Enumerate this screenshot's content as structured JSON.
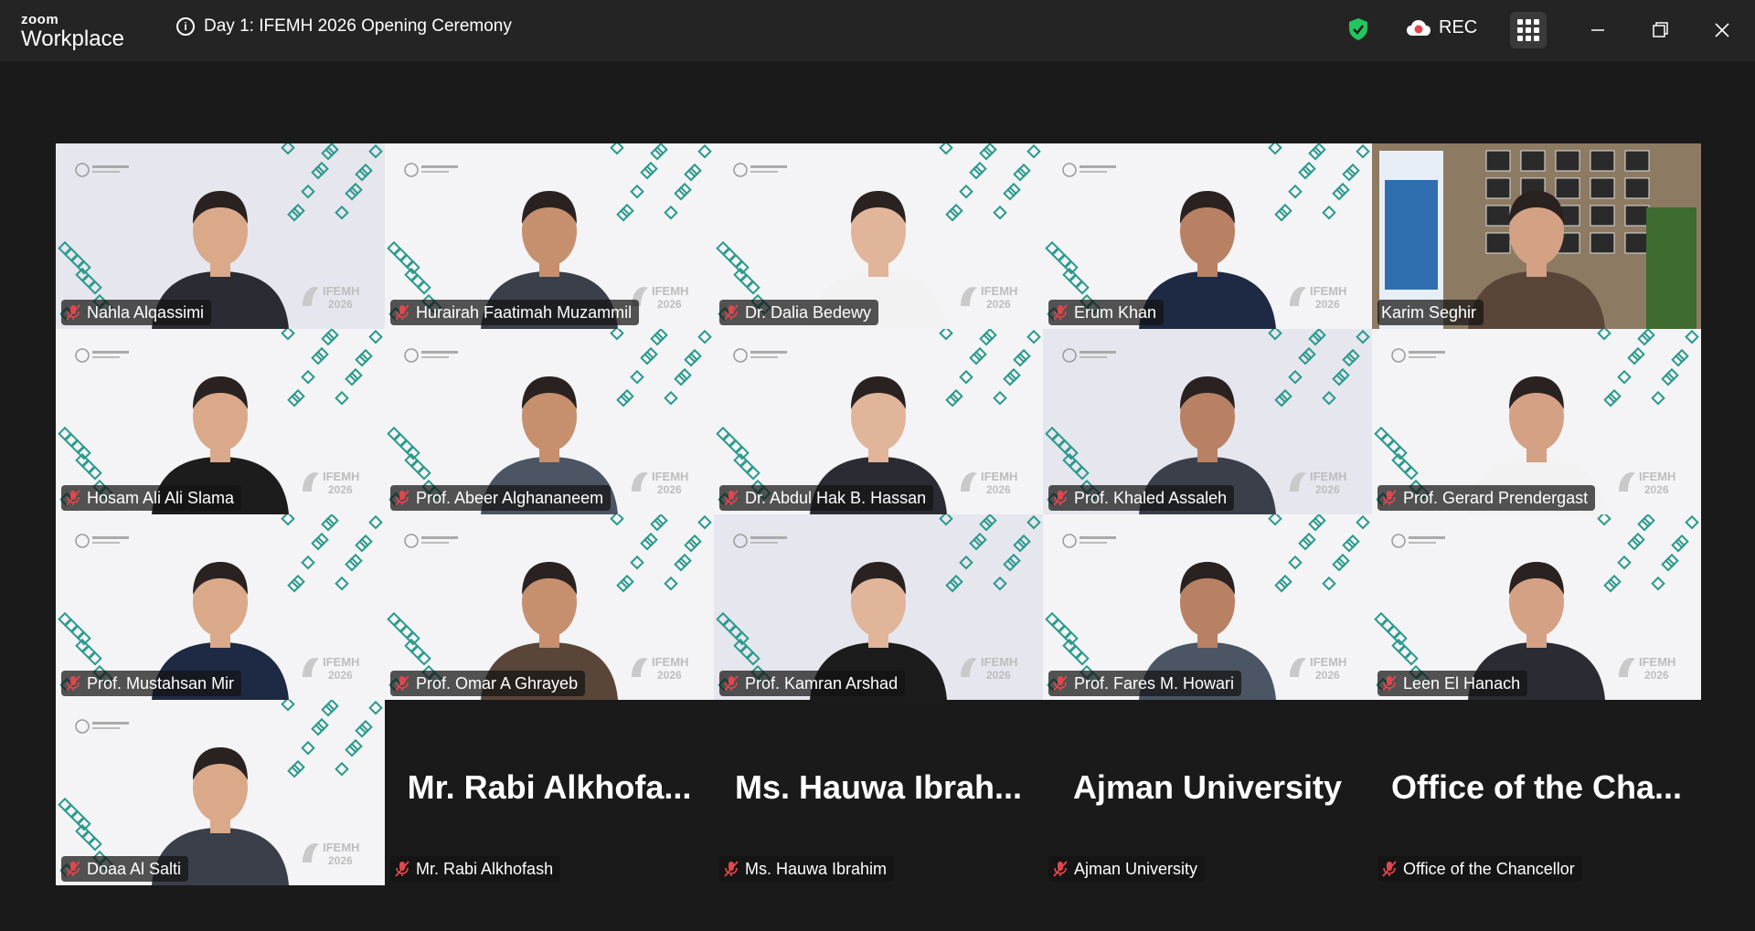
{
  "app": {
    "brand_top": "zoom",
    "brand_bottom": "Workplace"
  },
  "meeting": {
    "title": "Day 1: IFEMH 2026 Opening Ceremony"
  },
  "toolbar": {
    "rec_label": "REC"
  },
  "colors": {
    "titlebar_bg": "#242424",
    "page_bg": "#1a1a1a",
    "active_border": "#22c55e",
    "shield": "#22c55e",
    "mute": "#e0474c",
    "pattern": "#2b9a8c"
  },
  "participants": [
    {
      "name": "Nahla Alqassimi",
      "video": true,
      "muted": true
    },
    {
      "name": "Hurairah Faatimah Muzammil",
      "video": true,
      "muted": true
    },
    {
      "name": "Dr. Dalia Bedewy",
      "video": true,
      "muted": true
    },
    {
      "name": "Erum Khan",
      "video": true,
      "muted": true
    },
    {
      "name": "Karim Seghir",
      "video": true,
      "muted": false,
      "speaking": true
    },
    {
      "name": "Hosam Ali Ali Slama",
      "video": true,
      "muted": true
    },
    {
      "name": "Prof. Abeer Alghananeem",
      "video": true,
      "muted": true
    },
    {
      "name": "Dr. Abdul Hak B. Hassan",
      "video": true,
      "muted": true
    },
    {
      "name": "Prof. Khaled Assaleh",
      "video": true,
      "muted": true
    },
    {
      "name": "Prof. Gerard Prendergast",
      "video": true,
      "muted": true
    },
    {
      "name": "Prof. Mustahsan Mir",
      "video": true,
      "muted": true
    },
    {
      "name": "Prof. Omar A Ghrayeb",
      "video": true,
      "muted": true
    },
    {
      "name": "Prof. Kamran Arshad",
      "video": true,
      "muted": true
    },
    {
      "name": "Prof. Fares M. Howari",
      "video": true,
      "muted": true
    },
    {
      "name": "Leen El Hanach",
      "video": true,
      "muted": true
    },
    {
      "name": "Doaa Al Salti",
      "video": true,
      "muted": true
    },
    {
      "name": "Mr. Rabi Alkhofash",
      "display": "Mr. Rabi Alkhofa...",
      "video": false,
      "muted": true
    },
    {
      "name": "Ms. Hauwa Ibrahim",
      "display": "Ms. Hauwa Ibrah...",
      "video": false,
      "muted": true
    },
    {
      "name": "Ajman University",
      "display": "Ajman University",
      "video": false,
      "muted": true
    },
    {
      "name": "Office of the Chancellor",
      "display": "Office of the Cha...",
      "video": false,
      "muted": true
    }
  ]
}
